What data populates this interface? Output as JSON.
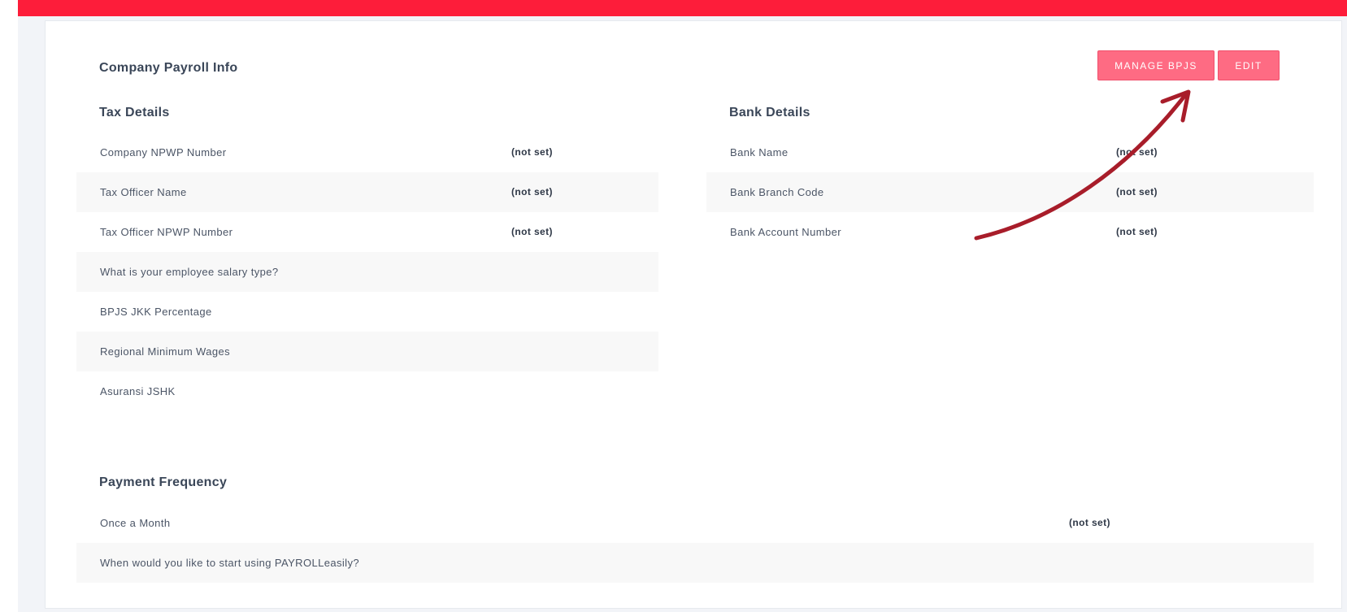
{
  "card": {
    "title": "Company Payroll Info",
    "buttons": {
      "manage_bpjs": "MANAGE BPJS",
      "edit": "EDIT"
    }
  },
  "tax_details": {
    "title": "Tax Details",
    "rows": [
      {
        "label": "Company NPWP Number",
        "value": "(not set)"
      },
      {
        "label": "Tax Officer Name",
        "value": "(not set)"
      },
      {
        "label": "Tax Officer NPWP Number",
        "value": "(not set)"
      },
      {
        "label": "What is your employee salary type?",
        "value": ""
      },
      {
        "label": "BPJS JKK Percentage",
        "value": ""
      },
      {
        "label": "Regional Minimum Wages",
        "value": ""
      },
      {
        "label": "Asuransi JSHK",
        "value": ""
      }
    ]
  },
  "bank_details": {
    "title": "Bank Details",
    "rows": [
      {
        "label": "Bank Name",
        "value": "(not set)"
      },
      {
        "label": "Bank Branch Code",
        "value": "(not set)"
      },
      {
        "label": "Bank Account Number",
        "value": "(not set)"
      }
    ]
  },
  "payment_frequency": {
    "title": "Payment Frequency",
    "rows": [
      {
        "label": "Once a Month",
        "value": "(not set)"
      },
      {
        "label": "When would you like to start using PAYROLLeasily?",
        "value": ""
      }
    ]
  },
  "colors": {
    "topbar": "#fd1d3a",
    "button": "#fe6b83",
    "arrow": "#a81d2a",
    "stripe": "#f8f8f8"
  }
}
